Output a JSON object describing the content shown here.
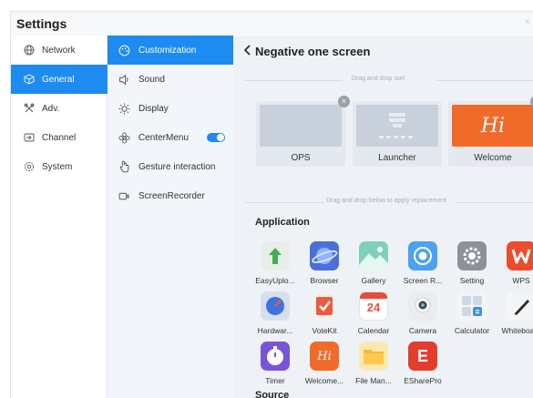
{
  "window": {
    "title": "Settings",
    "close_glyph": "×"
  },
  "primary_nav": [
    {
      "label": "Network",
      "icon": "globe-icon"
    },
    {
      "label": "General",
      "icon": "cube-icon",
      "active": true
    },
    {
      "label": "Adv.",
      "icon": "tools-icon"
    },
    {
      "label": "Channel",
      "icon": "input-icon"
    },
    {
      "label": "System",
      "icon": "gear-icon"
    }
  ],
  "secondary_nav": [
    {
      "label": "Customization",
      "icon": "palette-icon",
      "active": true
    },
    {
      "label": "Sound",
      "icon": "speaker-icon"
    },
    {
      "label": "Display",
      "icon": "sun-icon"
    },
    {
      "label": "CenterMenu",
      "icon": "flower-icon",
      "toggle": "on"
    },
    {
      "label": "Gesture interaction",
      "icon": "hand-icon"
    },
    {
      "label": "ScreenRecorder",
      "icon": "record-icon"
    }
  ],
  "main": {
    "title": "Negative one screen",
    "drag_hint": "Drag and drop sort",
    "replace_hint": "Drag and drop below to apply replacement",
    "cards": [
      {
        "label": "OPS",
        "removable": true
      },
      {
        "label": "Launcher",
        "removable": false
      },
      {
        "label": "Welcome",
        "removable": true,
        "thumb_text": "Hi"
      }
    ],
    "application_heading": "Application",
    "source_heading": "Source",
    "apps": [
      {
        "label": "EasyUplo...",
        "icon": "upload-icon"
      },
      {
        "label": "Browser",
        "icon": "planet-icon"
      },
      {
        "label": "Gallery",
        "icon": "mountain-icon"
      },
      {
        "label": "Screen R...",
        "icon": "record-icon"
      },
      {
        "label": "Setting",
        "icon": "gear-icon"
      },
      {
        "label": "WPS",
        "icon": "wps-icon"
      },
      {
        "label": "Hardwar...",
        "icon": "gauge-icon"
      },
      {
        "label": "VoteKit",
        "icon": "vote-icon"
      },
      {
        "label": "Calendar",
        "icon": "calendar-icon",
        "text": "24"
      },
      {
        "label": "Camera",
        "icon": "camera-icon"
      },
      {
        "label": "Calculator",
        "icon": "calculator-icon"
      },
      {
        "label": "Whiteboa...",
        "icon": "pen-icon"
      },
      {
        "label": "Timer",
        "icon": "stopwatch-icon"
      },
      {
        "label": "Welcome...",
        "icon": "hi-icon",
        "text": "Hi"
      },
      {
        "label": "File Man...",
        "icon": "folder-icon"
      },
      {
        "label": "ESharePro",
        "icon": "eshare-icon",
        "text": "E"
      }
    ]
  },
  "colors": {
    "accent": "#1e8bf0",
    "wps": "#ec4b2c",
    "welcome": "#f06b2a"
  }
}
